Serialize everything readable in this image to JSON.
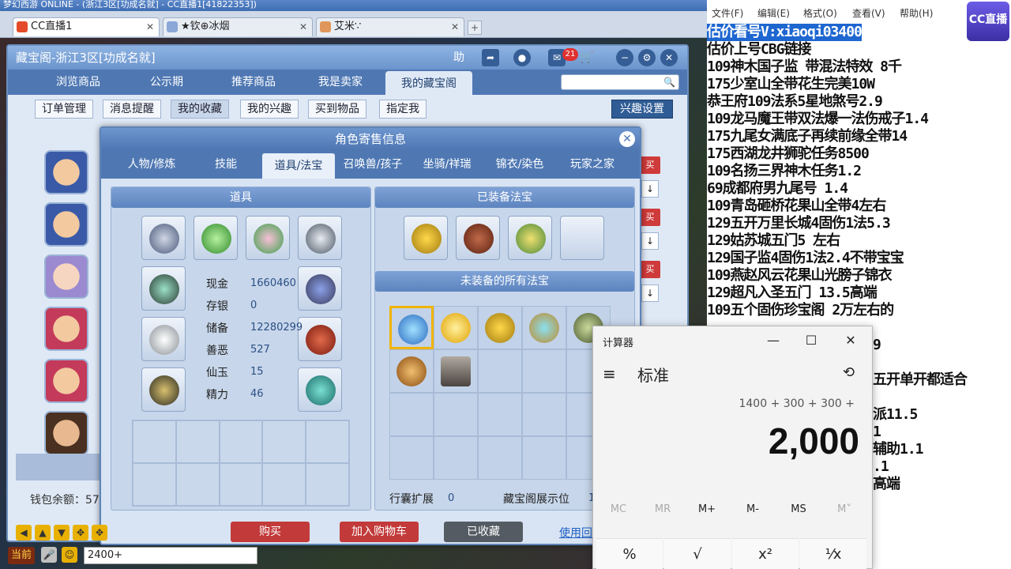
{
  "client": {
    "title_bar": "梦幻西游 ONLINE - (浙江3区[功成名就] - CC直播1[41822353])",
    "tabs": [
      {
        "label": "CC直播1"
      },
      {
        "label": "★钦⊕冰烟"
      },
      {
        "label": "艾米∵"
      }
    ],
    "new_tab": "+"
  },
  "cbg": {
    "title": "藏宝阁-浙江3区[功成名就]",
    "help_label": "助",
    "cart_badge": "21",
    "nav": [
      "浏览商品",
      "公示期",
      "推荐商品",
      "我是卖家",
      "我的藏宝阁"
    ],
    "subnav": [
      "订单管理",
      "消息提醒",
      "我的收藏",
      "我的兴趣",
      "买到物品",
      "指定我"
    ],
    "interest_button": "兴趣设置",
    "stub_buy": "买",
    "stub_arrow": "↓",
    "wallet": "钱包余额：57"
  },
  "dialog": {
    "title": "角色寄售信息",
    "tabs": [
      "人物/修炼",
      "技能",
      "道具/法宝",
      "召唤兽/孩子",
      "坐骑/祥瑞",
      "锦衣/染色",
      "玩家之家"
    ],
    "items_head": "道具",
    "equipped_head": "已装备法宝",
    "unequipped_head": "未装备的所有法宝",
    "stats": [
      {
        "label": "现金",
        "value": "1660460"
      },
      {
        "label": "存银",
        "value": "0"
      },
      {
        "label": "储备",
        "value": "12280299"
      },
      {
        "label": "善恶",
        "value": "527"
      },
      {
        "label": "仙玉",
        "value": "15"
      },
      {
        "label": "精力",
        "value": "46"
      }
    ],
    "bag_expand_label": "行囊扩展",
    "bag_expand_value": "0",
    "cbg_display_label": "藏宝阁展示位",
    "cbg_display_value": "1",
    "buttons": {
      "buy": "购买",
      "add_cart": "加入购物车",
      "favorited": "已收藏"
    },
    "use_link": "使用回"
  },
  "hud": {
    "now_label": "当前",
    "chat_value": "2400+"
  },
  "notepad": {
    "menu": [
      "文件(F)",
      "编辑(E)",
      "格式(O)",
      "查看(V)",
      "帮助(H)"
    ],
    "lines": [
      "估价看号V:xiaoqi03400",
      "估价上号CBG链接",
      "109神木国子监 带混法特效 8千",
      "175少室山全带花生完美10W",
      "恭王府109法系5星地煞号2.9",
      "109龙马魔王带双法爆一法伤戒子1.4",
      "175九尾女满底子再续前缘全带14",
      "175西湖龙井狮驼任务8500",
      "109名扬三界神木任务1.2",
      "69成都府男九尾号   1.4",
      "109青岛砸桥花果山全带4左右",
      "129五开万里长城4固伤1法5.3",
      "129姑苏城五门5 左右",
      "129国子监4固伤1法2.4不带宝宝",
      "109燕赵风云花果山光膀子锦衣",
      "129超凡入圣五门    13.5高端",
      "109五个固伤珍宝阁 2万左右的",
      "9",
      "五开单开都适合",
      "派11.5",
      "1",
      "辅助1.1",
      ".1",
      "高端"
    ],
    "logo_text": "CC直播"
  },
  "calculator": {
    "title": "计算器",
    "minimize": "—",
    "maximize": "☐",
    "close": "✕",
    "mode": "标准",
    "expression": "1400 + 300 + 300 +",
    "display": "2,000",
    "memory": [
      "MC",
      "MR",
      "M+",
      "M-",
      "MS",
      "M˅"
    ],
    "keys": [
      "%",
      "√",
      "x²",
      "¹⁄x"
    ]
  }
}
